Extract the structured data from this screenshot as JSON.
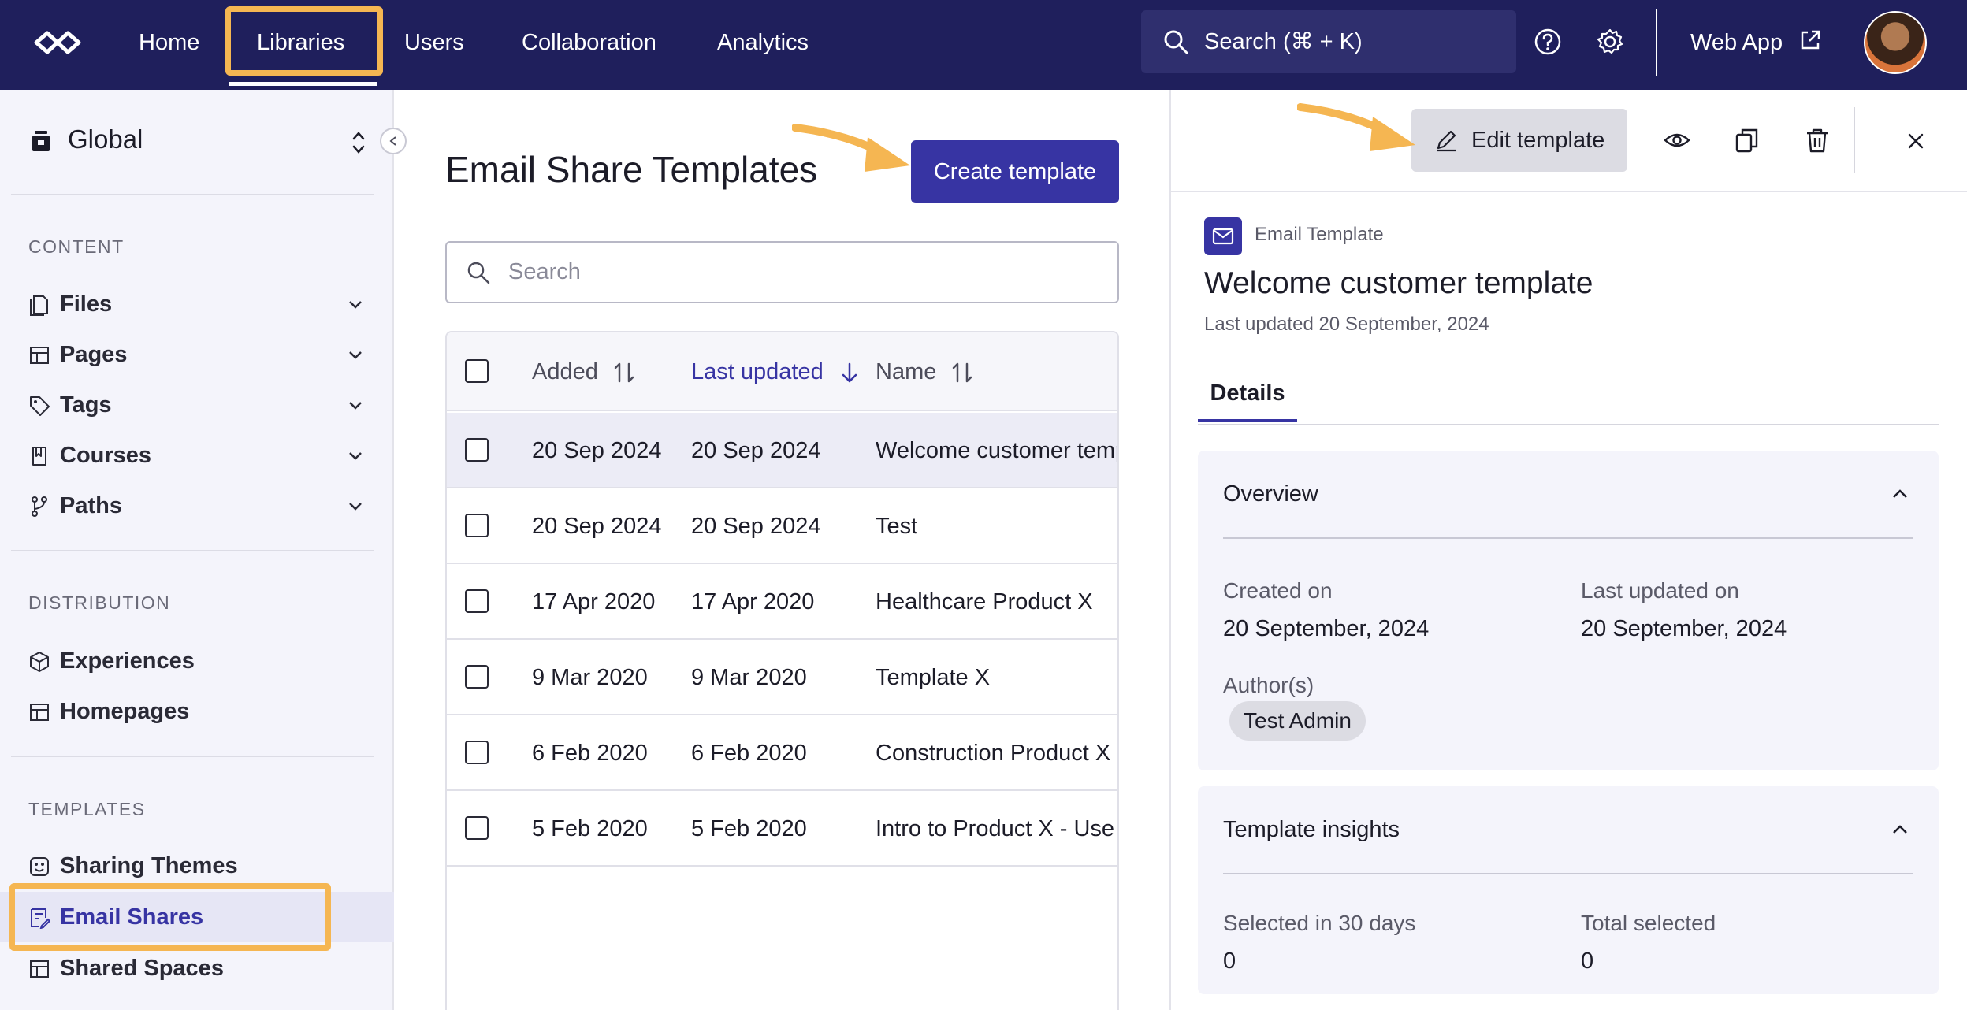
{
  "nav": {
    "items": [
      "Home",
      "Libraries",
      "Users",
      "Collaboration",
      "Analytics"
    ],
    "search_text": "Search (⌘ + K)",
    "web_app_label": "Web App"
  },
  "sidebar": {
    "scope_label": "Global",
    "sections": {
      "content": "CONTENT",
      "distribution": "DISTRIBUTION",
      "templates": "TEMPLATES"
    },
    "content_items": [
      "Files",
      "Pages",
      "Tags",
      "Courses",
      "Paths"
    ],
    "distribution_items": [
      "Experiences",
      "Homepages"
    ],
    "template_items": [
      "Sharing Themes",
      "Email Shares",
      "Shared Spaces"
    ],
    "active_item": "Email Shares"
  },
  "main": {
    "title": "Email Share Templates",
    "create_button": "Create template",
    "search_placeholder": "Search",
    "columns": [
      "Added",
      "Last updated",
      "Name"
    ],
    "rows": [
      {
        "added": "20 Sep 2024",
        "updated": "20 Sep 2024",
        "name": "Welcome customer template",
        "selected": true
      },
      {
        "added": "20 Sep 2024",
        "updated": "20 Sep 2024",
        "name": "Test",
        "selected": false
      },
      {
        "added": "17 Apr 2020",
        "updated": "17 Apr 2020",
        "name": "Healthcare Product X",
        "selected": false
      },
      {
        "added": "9 Mar 2020",
        "updated": "9 Mar 2020",
        "name": "Template X",
        "selected": false
      },
      {
        "added": "6 Feb 2020",
        "updated": "6 Feb 2020",
        "name": "Construction Product X",
        "selected": false
      },
      {
        "added": "5 Feb 2020",
        "updated": "5 Feb 2020",
        "name": "Intro to Product X - Use",
        "selected": false
      }
    ]
  },
  "panel": {
    "edit_button": "Edit template",
    "type_label": "Email Template",
    "title": "Welcome customer template",
    "last_updated": "Last updated 20 September, 2024",
    "tab": "Details",
    "overview": {
      "title": "Overview",
      "created_label": "Created on",
      "created_value": "20 September, 2024",
      "updated_label": "Last updated on",
      "updated_value": "20 September, 2024",
      "authors_label": "Author(s)",
      "author": "Test Admin"
    },
    "insights": {
      "title": "Template insights",
      "selected30_label": "Selected in 30 days",
      "selected30_value": "0",
      "total_label": "Total selected",
      "total_value": "0"
    }
  },
  "colors": {
    "nav_bg": "#1f1f5c",
    "accent": "#3734a3",
    "highlight": "#f5b652"
  }
}
